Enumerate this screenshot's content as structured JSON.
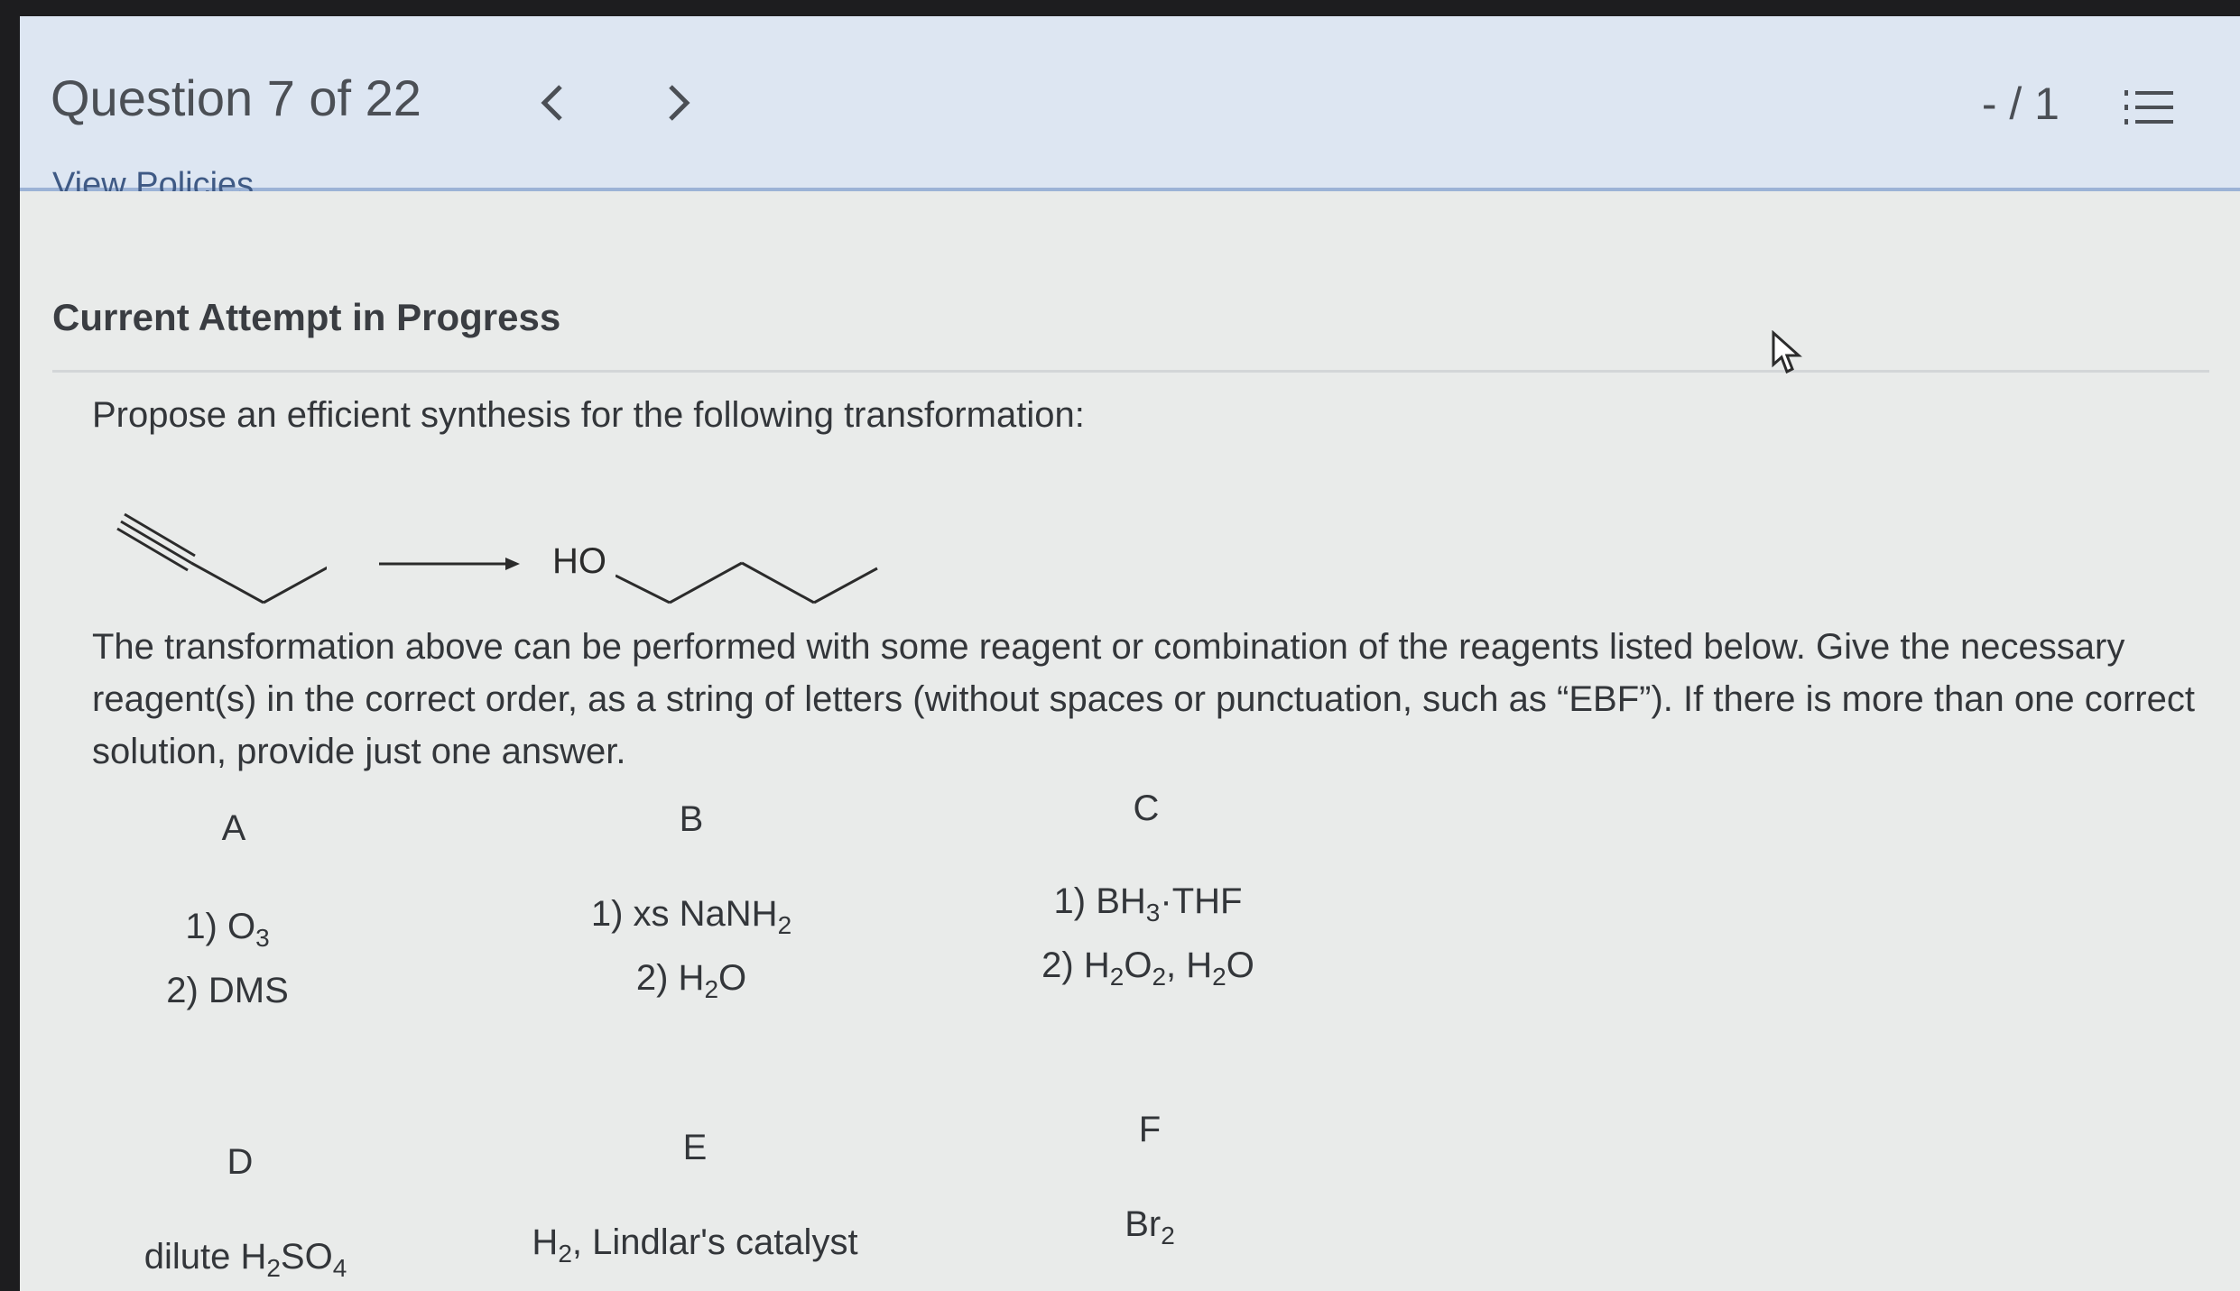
{
  "header": {
    "question_counter": "Question 7 of 22",
    "prev_icon": "chevron-left-icon",
    "next_icon": "chevron-right-icon",
    "score": "- / 1",
    "list_icon": "numbered-list-icon"
  },
  "policies_link": "View Policies",
  "attempt_heading": "Current Attempt in Progress",
  "prompt": "Propose an efficient synthesis for the following transformation:",
  "reaction": {
    "product_label": "HO"
  },
  "instructions": "The transformation above can be performed with some reagent or combination of the reagents listed below. Give the necessary reagent(s) in the correct order, as a string of letters (without spaces or punctuation, such as “EBF”). If there is more than one correct solution, provide just one answer.",
  "options": [
    {
      "letter": "A",
      "step1_prefix": "1) O",
      "step1_sub": "3",
      "step2": "2) DMS"
    },
    {
      "letter": "B",
      "step1_prefix": "1) xs NaNH",
      "step1_sub": "2",
      "step2_prefix": "2) H",
      "step2_sub": "2",
      "step2_suffix": "O"
    },
    {
      "letter": "C",
      "step1_prefix": "1) BH",
      "step1_sub": "3",
      "step1_suffix": "·THF",
      "step2_a": "2) H",
      "step2_sub1": "2",
      "step2_b": "O",
      "step2_sub2": "2",
      "step2_c": ", H",
      "step2_sub3": "2",
      "step2_d": "O"
    },
    {
      "letter": "D",
      "text_prefix": "dilute H",
      "text_sub1": "2",
      "text_mid": "SO",
      "text_sub2": "4"
    },
    {
      "letter": "E",
      "text_prefix": "H",
      "text_sub": "2",
      "text_suffix": ", Lindlar's catalyst"
    },
    {
      "letter": "F",
      "text_prefix": "Br",
      "text_sub": "2"
    }
  ],
  "colors": {
    "header_bg": "#dde6f2",
    "link": "#3f5a85",
    "text": "#33363a",
    "page_bg": "#e9ebea"
  }
}
